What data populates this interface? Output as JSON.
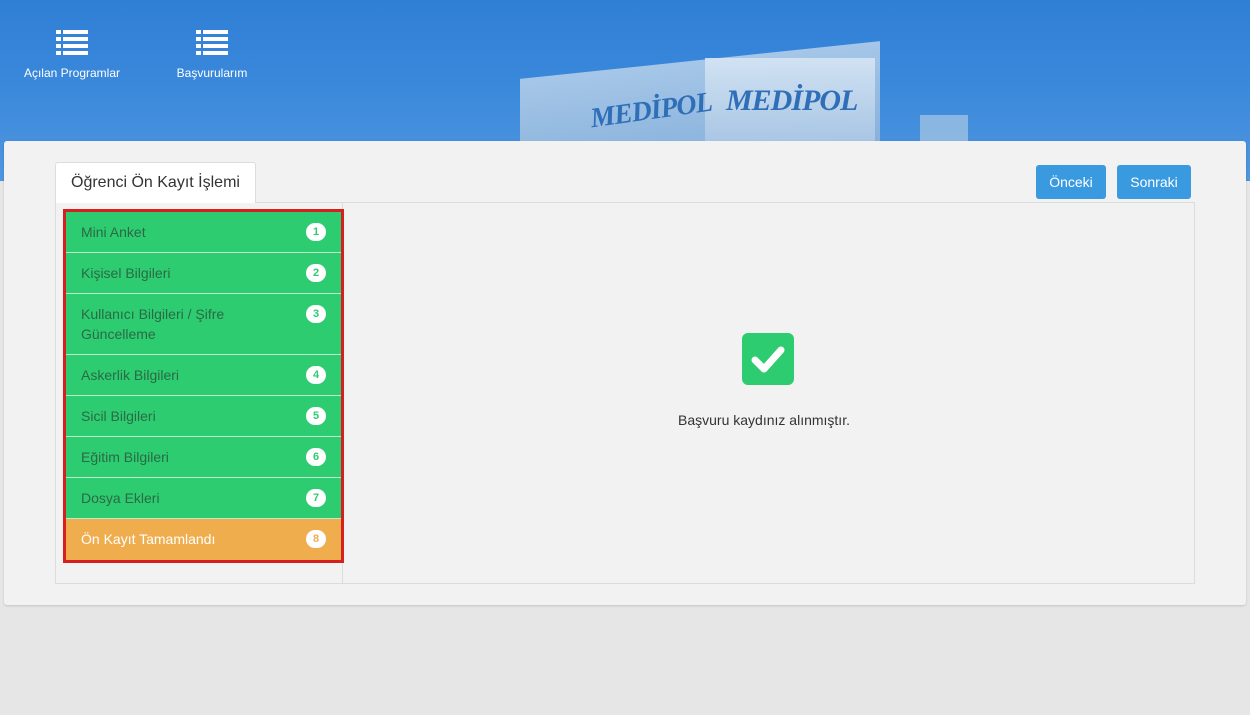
{
  "header": {
    "nav": [
      {
        "label": "Açılan Programlar",
        "icon": "list-icon"
      },
      {
        "label": "Başvurularım",
        "icon": "list-icon"
      }
    ],
    "banner_logo_text": "MEDİPOL",
    "colors": {
      "banner": "#3a88db"
    }
  },
  "main": {
    "tab_label": "Öğrenci Ön Kayıt İşlemi",
    "buttons": {
      "prev": "Önceki",
      "next": "Sonraki"
    },
    "steps": [
      {
        "label": "Mini Anket",
        "number": "1"
      },
      {
        "label": "Kişisel Bilgileri",
        "number": "2"
      },
      {
        "label": "Kullanıcı Bilgileri / Şifre Güncelleme",
        "number": "3"
      },
      {
        "label": "Askerlik Bilgileri",
        "number": "4"
      },
      {
        "label": "Sicil Bilgileri",
        "number": "5"
      },
      {
        "label": "Eğitim Bilgileri",
        "number": "6"
      },
      {
        "label": "Dosya Ekleri",
        "number": "7"
      },
      {
        "label": "Ön Kayıt Tamamlandı",
        "number": "8",
        "active": true
      }
    ],
    "success_message": "Başvuru kaydınız alınmıştır.",
    "colors": {
      "completed": "#2ecc71",
      "active": "#f0ad4e",
      "button": "#3a9ae0",
      "highlight_border": "#d62020"
    }
  }
}
